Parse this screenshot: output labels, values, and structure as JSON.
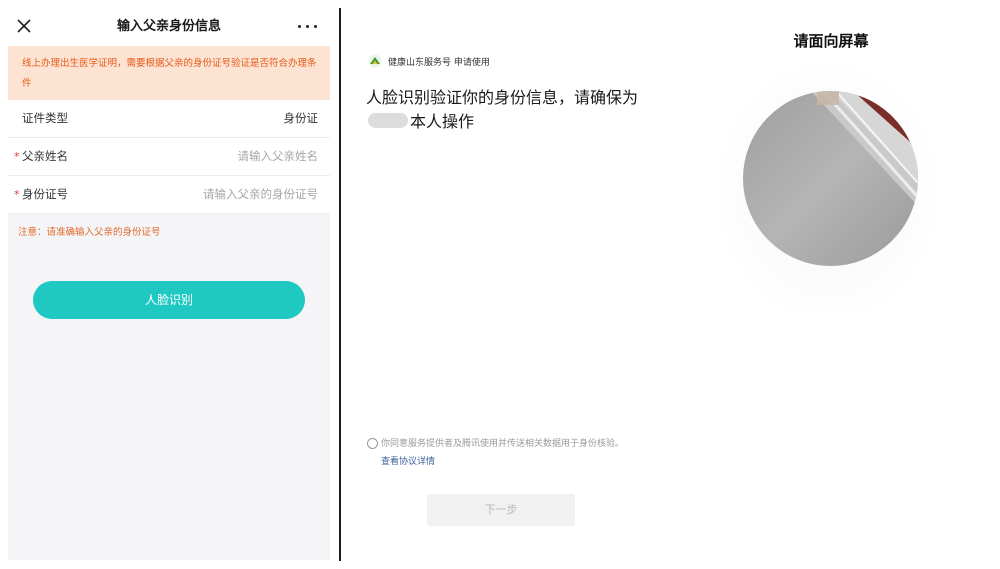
{
  "form_screen": {
    "title": "输入父亲身份信息",
    "notice": "线上办理出生医学证明，需要根据父亲的身份证号验证是否符合办理条件",
    "rows": [
      {
        "label": "证件类型",
        "value": "身份证"
      },
      {
        "label": "父亲姓名",
        "required_mark": "*",
        "placeholder": "请输入父亲姓名"
      },
      {
        "label": "身份证号",
        "required_mark": "*",
        "placeholder": "请输入父亲的身份证号"
      }
    ],
    "warning": "注意：请准确输入父亲的身份证号",
    "face_button": "人脸识别",
    "icons": {
      "close": "close-icon",
      "more": "more-icon"
    },
    "colors": {
      "accent": "#1fc9c2",
      "notice_bg": "#fde3d2",
      "notice_text": "#e65a1a",
      "required": "#e23a3a"
    }
  },
  "verify_screen": {
    "service_name": "健康山东服务号 申请使用",
    "instruction_pre": "人脸识别验证你的身份信息，请确保为",
    "instruction_post": "本人操作",
    "consent_text": "你同意服务提供者及腾讯使用并传送相关数据用于身份核验。",
    "consent_link": "查看协议详情",
    "next_button": "下一步",
    "icons": {
      "logo": "service-logo-icon"
    }
  },
  "camera_screen": {
    "title": "请面向屏幕"
  }
}
